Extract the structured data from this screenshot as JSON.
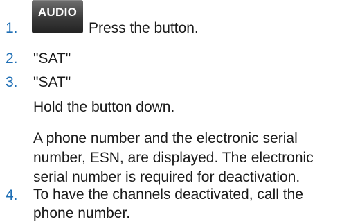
{
  "steps": [
    {
      "number": "1.",
      "button_label": "AUDIO",
      "text": "Press the button."
    },
    {
      "number": "2.",
      "text": "\"SAT\""
    },
    {
      "number": "3.",
      "text": "\"SAT\""
    },
    {
      "number": "4.",
      "text": "To have the channels deactivated, call the phone number."
    }
  ],
  "step3_notes": [
    "Hold the button down.",
    "A phone number and the electronic serial number, ESN, are displayed. The electronic serial number is required for deactivation."
  ],
  "colors": {
    "step_number": "#1f6fb5",
    "text": "#1a1a1a",
    "button_bg": "#3a3a3a",
    "button_text": "#ffffff"
  }
}
